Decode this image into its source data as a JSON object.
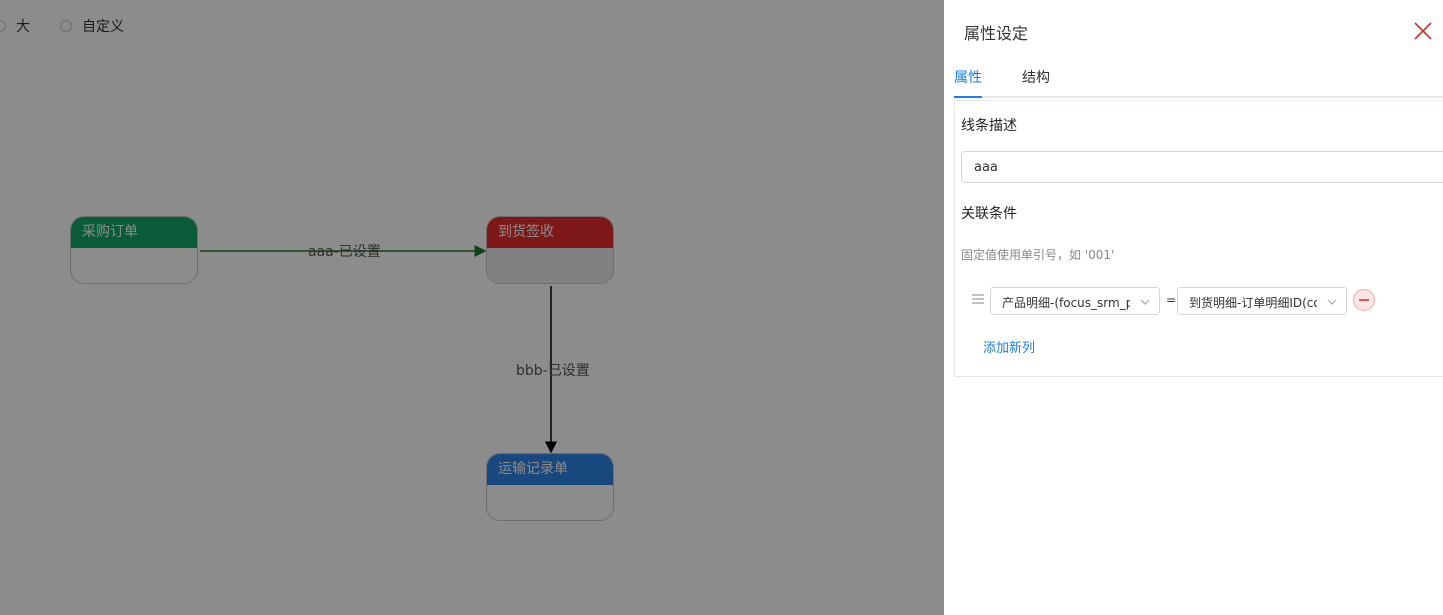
{
  "size_options": [
    {
      "label": "大"
    },
    {
      "label": "自定义"
    }
  ],
  "flow": {
    "nodes": {
      "purchase": {
        "title": "采购订单",
        "color": "#12a76a"
      },
      "arrival": {
        "title": "到货签收",
        "color": "#e62a2a"
      },
      "transport": {
        "title": "运输记录单",
        "color": "#2f84e5"
      }
    },
    "edges": [
      {
        "label": "aaa-已设置"
      },
      {
        "label": "bbb-已设置"
      }
    ]
  },
  "drawer": {
    "title": "属性设定",
    "tabs": [
      {
        "label": "属性",
        "active": true
      },
      {
        "label": "结构",
        "active": false
      }
    ],
    "line_desc_label": "线条描述",
    "line_desc_value": "aaa",
    "condition_label": "关联条件",
    "hint": "固定值使用单引号，如 '001'",
    "condition": {
      "left_select": "产品明细-(focus_srm_p",
      "operator": "=",
      "right_select": "到货明细-订单明细ID(co"
    },
    "add_label": "添加新列"
  },
  "colors": {
    "accent": "#1e7fe0",
    "danger": "#e65252",
    "close_icon": "#c0392b"
  }
}
